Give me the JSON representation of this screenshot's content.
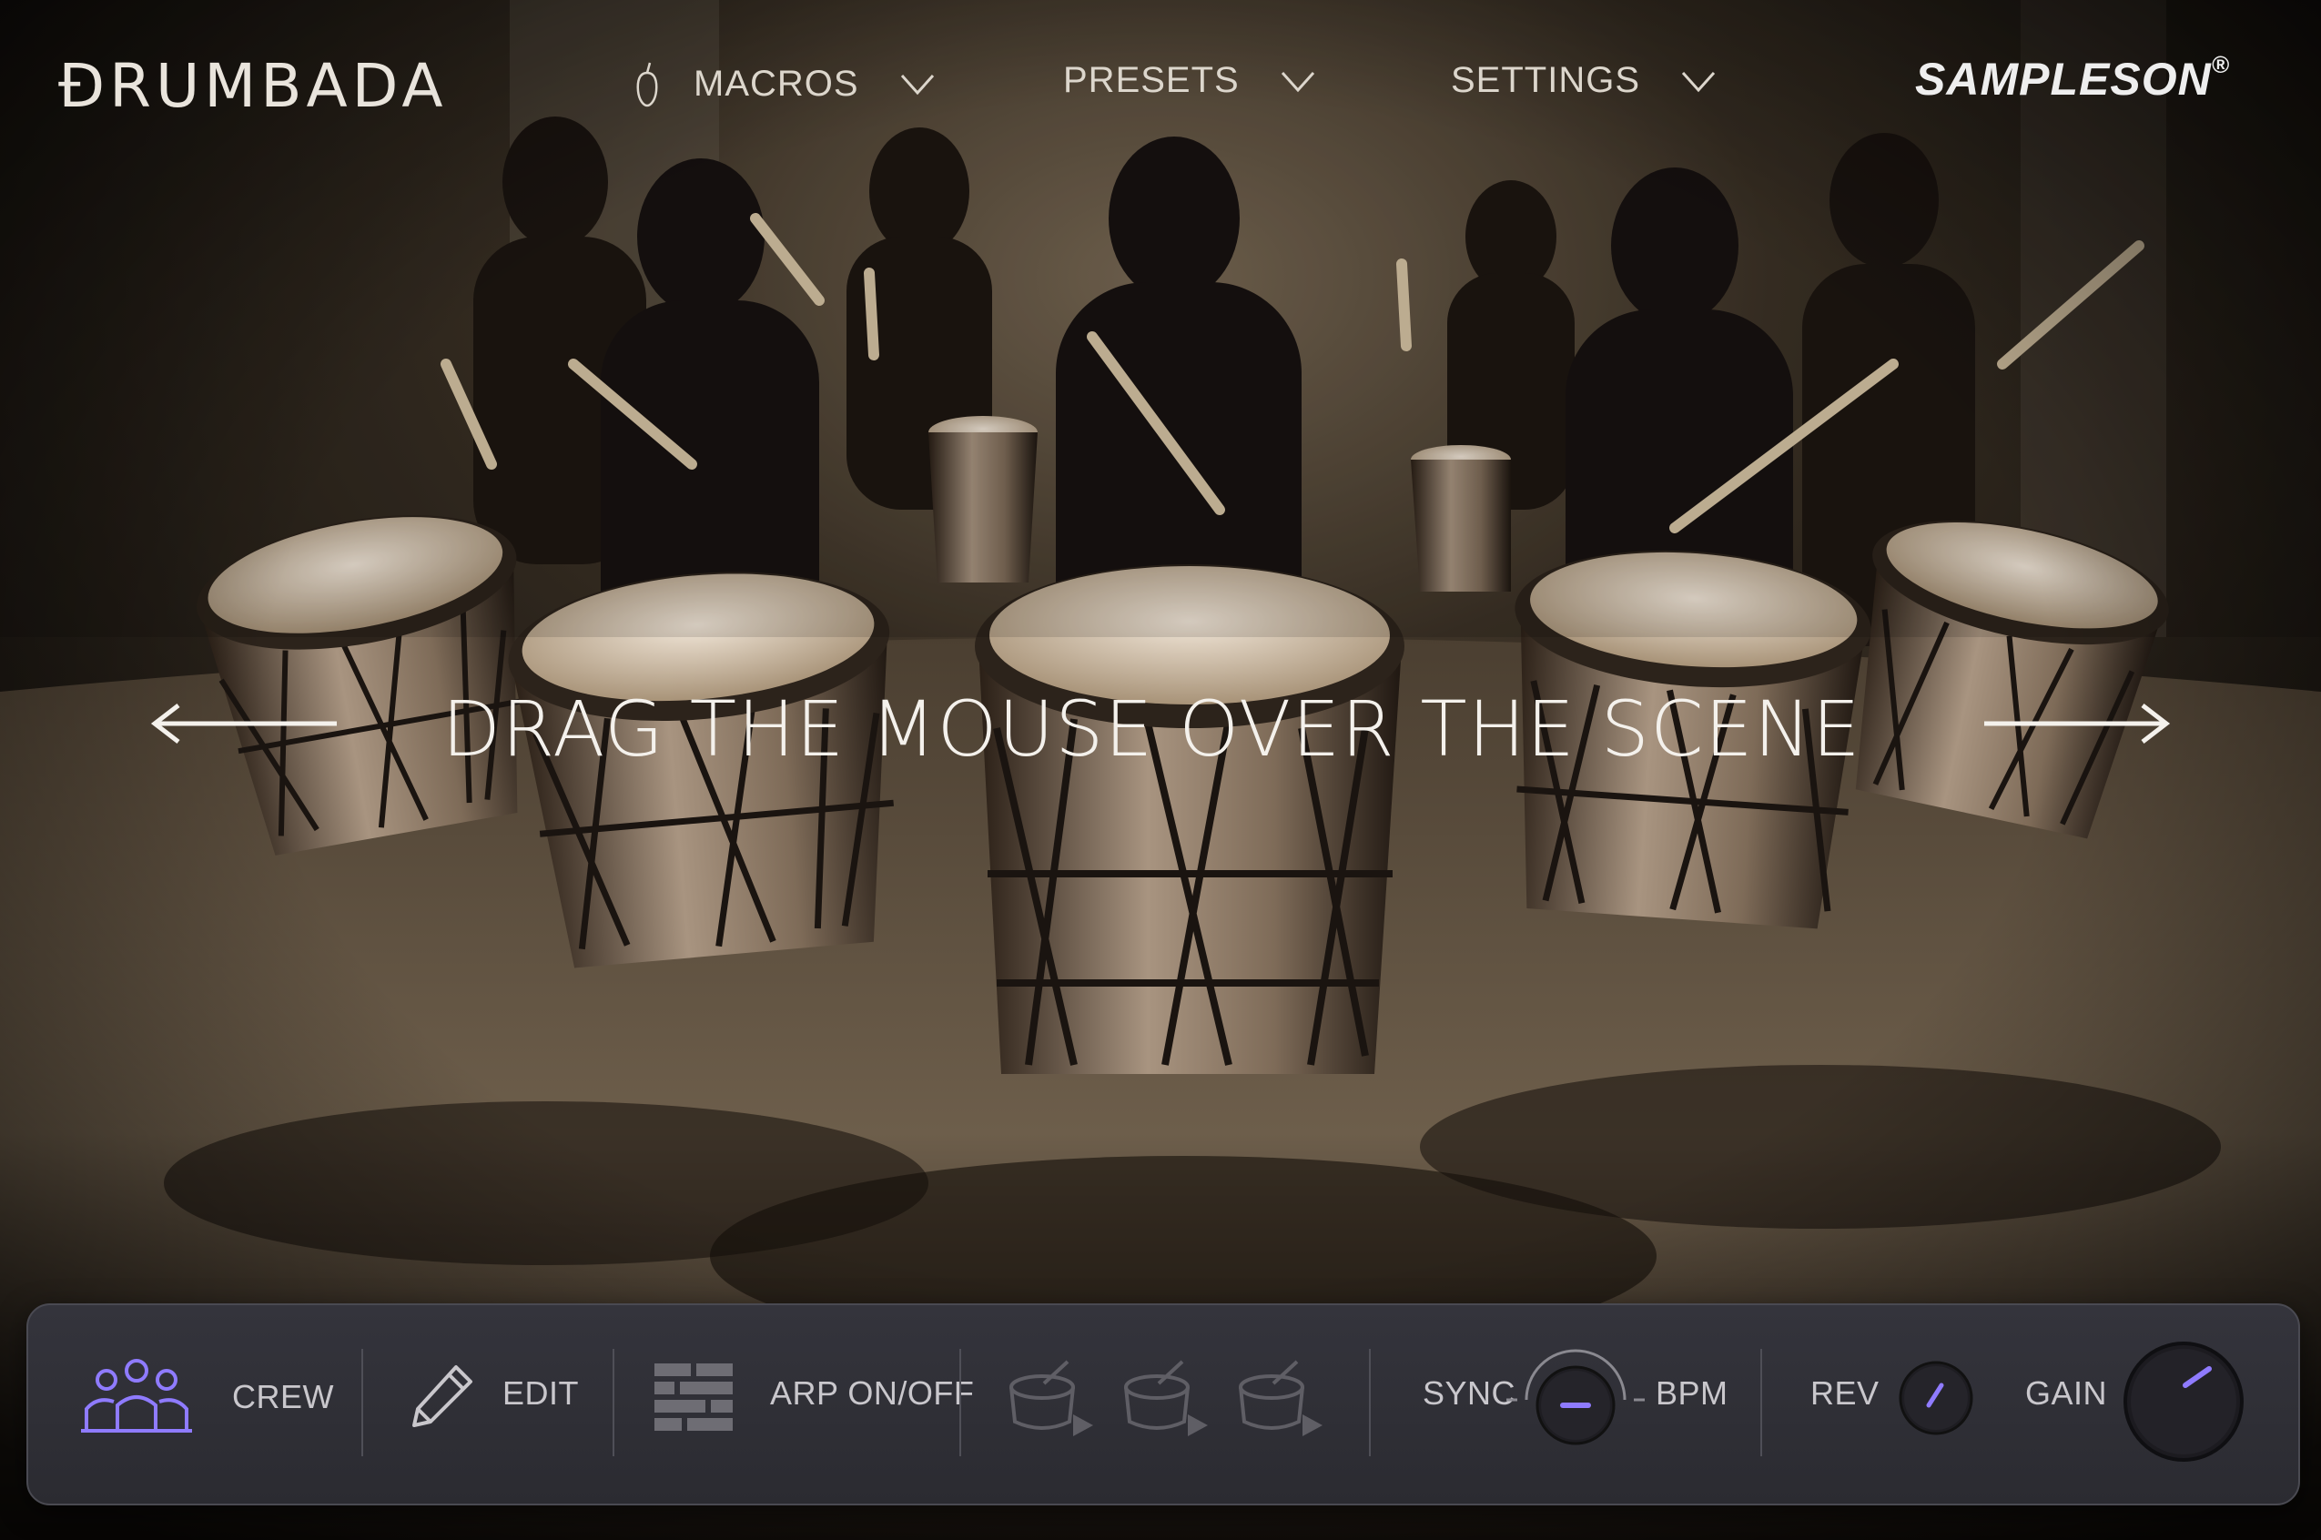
{
  "app": {
    "logo": "ĐRUMBADA",
    "brand": "SAMPLESON",
    "brand_mark": "®"
  },
  "menus": [
    {
      "label": "MACROS"
    },
    {
      "label": "PRESETS"
    },
    {
      "label": "SETTINGS"
    }
  ],
  "prompt": {
    "text": "DRAG THE MOUSE OVER THE SCENE"
  },
  "panel": {
    "crew_label": "CREW",
    "edit_label": "EDIT",
    "arp_label": "ARP ON/OFF",
    "sync_label": "SYNC",
    "bpm_label": "BPM",
    "rev_label": "REV",
    "gain_label": "GAIN"
  },
  "colors": {
    "accent": "#8f7bff",
    "panel": "#2f2f35",
    "text": "#dcd6cc"
  },
  "icons": [
    "apple-icon",
    "chevron-down-icon",
    "arrow-left-icon",
    "arrow-right-icon",
    "crew-icon",
    "pencil-icon",
    "arp-grid-icon",
    "drum-play-icon",
    "knob-icon"
  ]
}
